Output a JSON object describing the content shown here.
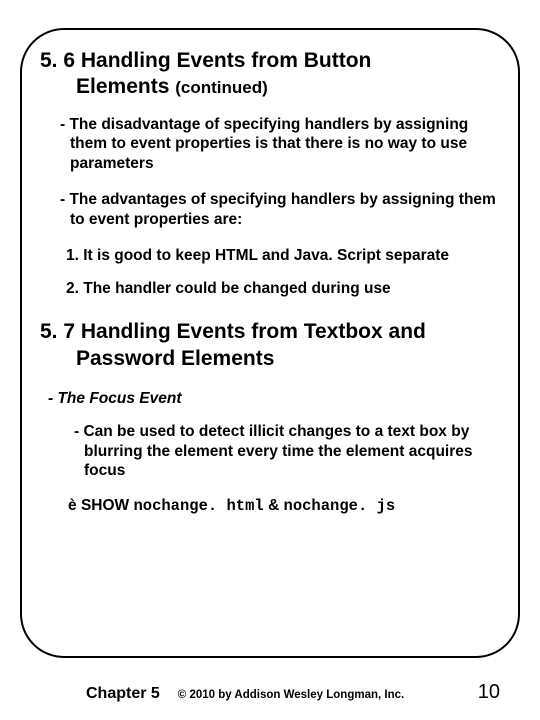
{
  "section56": {
    "title_line1": "5. 6 Handling Events from Button",
    "title_line2": "Elements",
    "continued": "(continued)",
    "bullet1": "- The disadvantage of specifying handlers by assigning them to event properties is that there is no way to use parameters",
    "bullet2": "- The advantages of specifying handlers by assigning them to event properties are:",
    "num1": "1. It is good to keep HTML and Java. Script separate",
    "num2": "2. The handler could be changed during use"
  },
  "section57": {
    "title_line1": "5. 7 Handling Events from Textbox and",
    "title_line2": "Password Elements",
    "focus_label": "- The Focus Event",
    "sub1": "- Can be used to detect illicit changes to a text box by blurring the element every time the element acquires focus",
    "arrow": "è",
    "show_label": "SHOW",
    "file1": "nochange. html",
    "amp": "&",
    "file2": "nochange. js"
  },
  "footer": {
    "chapter": "Chapter 5",
    "copyright": "© 2010 by Addison Wesley Longman, Inc.",
    "page": "10"
  }
}
